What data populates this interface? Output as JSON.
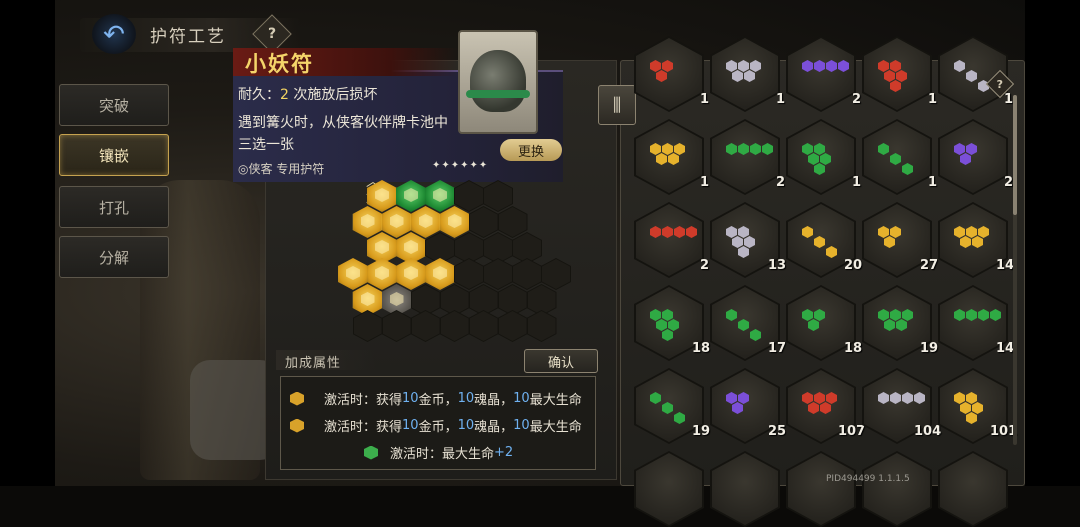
{
  "header": {
    "title": "护符工艺",
    "help": "?"
  },
  "tabs": [
    {
      "label": "突破",
      "active": false
    },
    {
      "label": "镶嵌",
      "active": true
    },
    {
      "label": "打孔",
      "active": false
    },
    {
      "label": "分解",
      "active": false
    }
  ],
  "card": {
    "name": "小妖符",
    "durability_prefix": "耐久：",
    "durability_value": "2",
    "durability_suffix": " 次施放后损坏",
    "effect_line1": "遇到篝火时，从侠客伙伴牌卡池中",
    "effect_line2": "三选一张",
    "exclusive": "侠客 专用护符",
    "stars": "✦✦✦✦✦✦",
    "swap_label": "更换"
  },
  "colors": {
    "gold": "#e6b22c",
    "green": "#2faa44",
    "purple": "#7b4fd8",
    "red": "#cf3b2a",
    "silver": "#b9b5c4",
    "accent_blue": "#6fb1f0"
  },
  "bonus": {
    "title": "加成属性",
    "confirm_label": "确认",
    "rows": [
      {
        "p1": "激活时：获得",
        "n1": "10",
        "p2": "金币，",
        "n2": "10",
        "p3": "魂晶，",
        "n3": "10",
        "p4": "最大生命",
        "gem": "gold"
      },
      {
        "p1": "激活时：获得",
        "n1": "10",
        "p2": "金币，",
        "n2": "10",
        "p3": "魂晶，",
        "n3": "10",
        "p4": "最大生命",
        "gem": "gold"
      },
      {
        "text": "激活时：最大生命",
        "plus": "+2",
        "gem": "green"
      }
    ]
  },
  "inventory": {
    "rows": [
      [
        {
          "color": "red",
          "count": "1"
        },
        {
          "color": "silver",
          "count": "1"
        },
        {
          "color": "purple",
          "count": "2"
        },
        {
          "color": "red",
          "count": "1"
        },
        {
          "color": "silver",
          "count": "1"
        }
      ],
      [
        {
          "color": "gold",
          "count": "1"
        },
        {
          "color": "green",
          "count": "2"
        },
        {
          "color": "green",
          "count": "1"
        },
        {
          "color": "green",
          "count": "1"
        },
        {
          "color": "purple",
          "count": "2"
        }
      ],
      [
        {
          "color": "red",
          "count": "2"
        },
        {
          "color": "silver",
          "count": "13"
        },
        {
          "color": "gold",
          "count": "20"
        },
        {
          "color": "gold",
          "count": "27"
        },
        {
          "color": "gold",
          "count": "14"
        }
      ],
      [
        {
          "color": "green",
          "count": "18"
        },
        {
          "color": "green",
          "count": "17"
        },
        {
          "color": "green",
          "count": "18"
        },
        {
          "color": "green",
          "count": "19"
        },
        {
          "color": "green",
          "count": "14"
        }
      ],
      [
        {
          "color": "green",
          "count": "19"
        },
        {
          "color": "purple",
          "count": "25"
        },
        {
          "color": "red",
          "count": "107"
        },
        {
          "color": "silver",
          "count": "104"
        },
        {
          "color": "gold",
          "count": "101"
        }
      ]
    ]
  },
  "footer": {
    "pid": "PID494499  1.1.1.5"
  }
}
